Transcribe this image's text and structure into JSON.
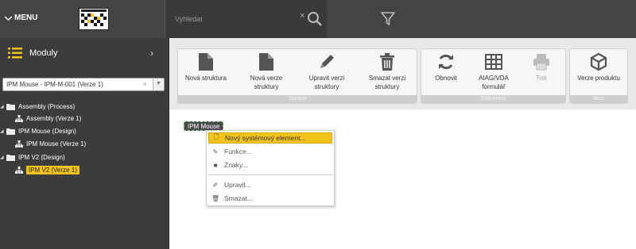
{
  "topbar": {
    "menu_label": "MENU",
    "search_placeholder": "Vyhledat",
    "clear_symbol": "×"
  },
  "sidebar": {
    "title": "Moduly",
    "selected_structure": "IPM Mouse - IPM-M-001 (Verze 1)",
    "tree": [
      {
        "label": "Assembly (Process)",
        "level": 0
      },
      {
        "label": "Assembly (Verze 1)",
        "level": 1
      },
      {
        "label": "IPM Mouse (Design)",
        "level": 0
      },
      {
        "label": "IPM Mouse (Verze 1)",
        "level": 1
      },
      {
        "label": "IPM V2 (Design)",
        "level": 0
      },
      {
        "label": "IPM V2 (Verze 1)",
        "level": 1,
        "selected": true
      }
    ]
  },
  "ribbon": {
    "groups": [
      {
        "title": "Správa",
        "buttons": [
          {
            "label": "Nová struktura",
            "icon": "file-icon"
          },
          {
            "label": "Nová verze struktury",
            "icon": "file-icon"
          },
          {
            "label": "Upravit verzi struktury",
            "icon": "pencil-icon"
          },
          {
            "label": "Smazat verzi struktury",
            "icon": "trash-icon"
          }
        ]
      },
      {
        "title": "Zobrazení",
        "buttons": [
          {
            "label": "Obnovit",
            "icon": "refresh-icon"
          },
          {
            "label": "AIAG/VDA formulář",
            "icon": "table-icon"
          },
          {
            "label": "Tisk",
            "icon": "print-icon",
            "disabled": true
          }
        ]
      },
      {
        "title": "Akce",
        "buttons": [
          {
            "label": "Verze produktu",
            "icon": "cube-icon"
          }
        ]
      }
    ]
  },
  "canvas": {
    "node_label": "IPM Mouse",
    "context_menu": [
      {
        "label": "Nový systémový element...",
        "icon": "new-doc-icon",
        "active": true
      },
      {
        "label": "Funkce...",
        "icon": "wrench-icon"
      },
      {
        "label": "Znaky...",
        "icon": "square-icon"
      },
      {
        "label": "Upravit...",
        "icon": "pencil-icon"
      },
      {
        "label": "Smazat...",
        "icon": "trash-icon"
      }
    ]
  },
  "colors": {
    "accent": "#f3c21c",
    "topbar": "#444444",
    "sidebar": "#3c3c3c",
    "ribbon": "#e9e9e9"
  }
}
